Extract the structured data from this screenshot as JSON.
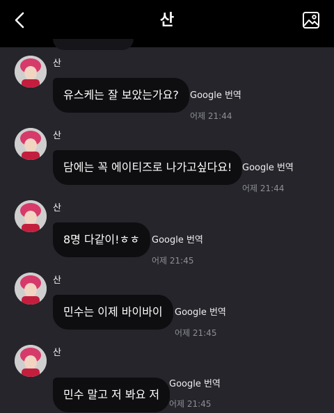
{
  "header": {
    "title": "산",
    "back_icon": "chevron-left-icon",
    "gallery_icon": "image-gallery-icon"
  },
  "messages": [
    {
      "sender": "산",
      "text": "유스케는 잘 보았는가요?",
      "translate": "Google 번역",
      "time": "어제 21:44"
    },
    {
      "sender": "산",
      "text": "담에는 꼭 에이티즈로 나가고싶다요!",
      "translate": "Google 번역",
      "time": "어제 21:44"
    },
    {
      "sender": "산",
      "text": "8명 다같이!ㅎㅎ",
      "translate": "Google 번역",
      "time": "어제 21:45"
    },
    {
      "sender": "산",
      "text": "민수는 이제 바이바이",
      "translate": "Google 번역",
      "time": "어제 21:45"
    },
    {
      "sender": "산",
      "text": "민수 말고 저 봐요 저",
      "translate": "Google 번역",
      "time": "어제 21:45"
    }
  ],
  "colors": {
    "background": "#25252b",
    "header": "#000000",
    "bubble": "#0e0e10",
    "timestamp": "#8e8e96",
    "avatar_hair": "#d63a6a"
  }
}
